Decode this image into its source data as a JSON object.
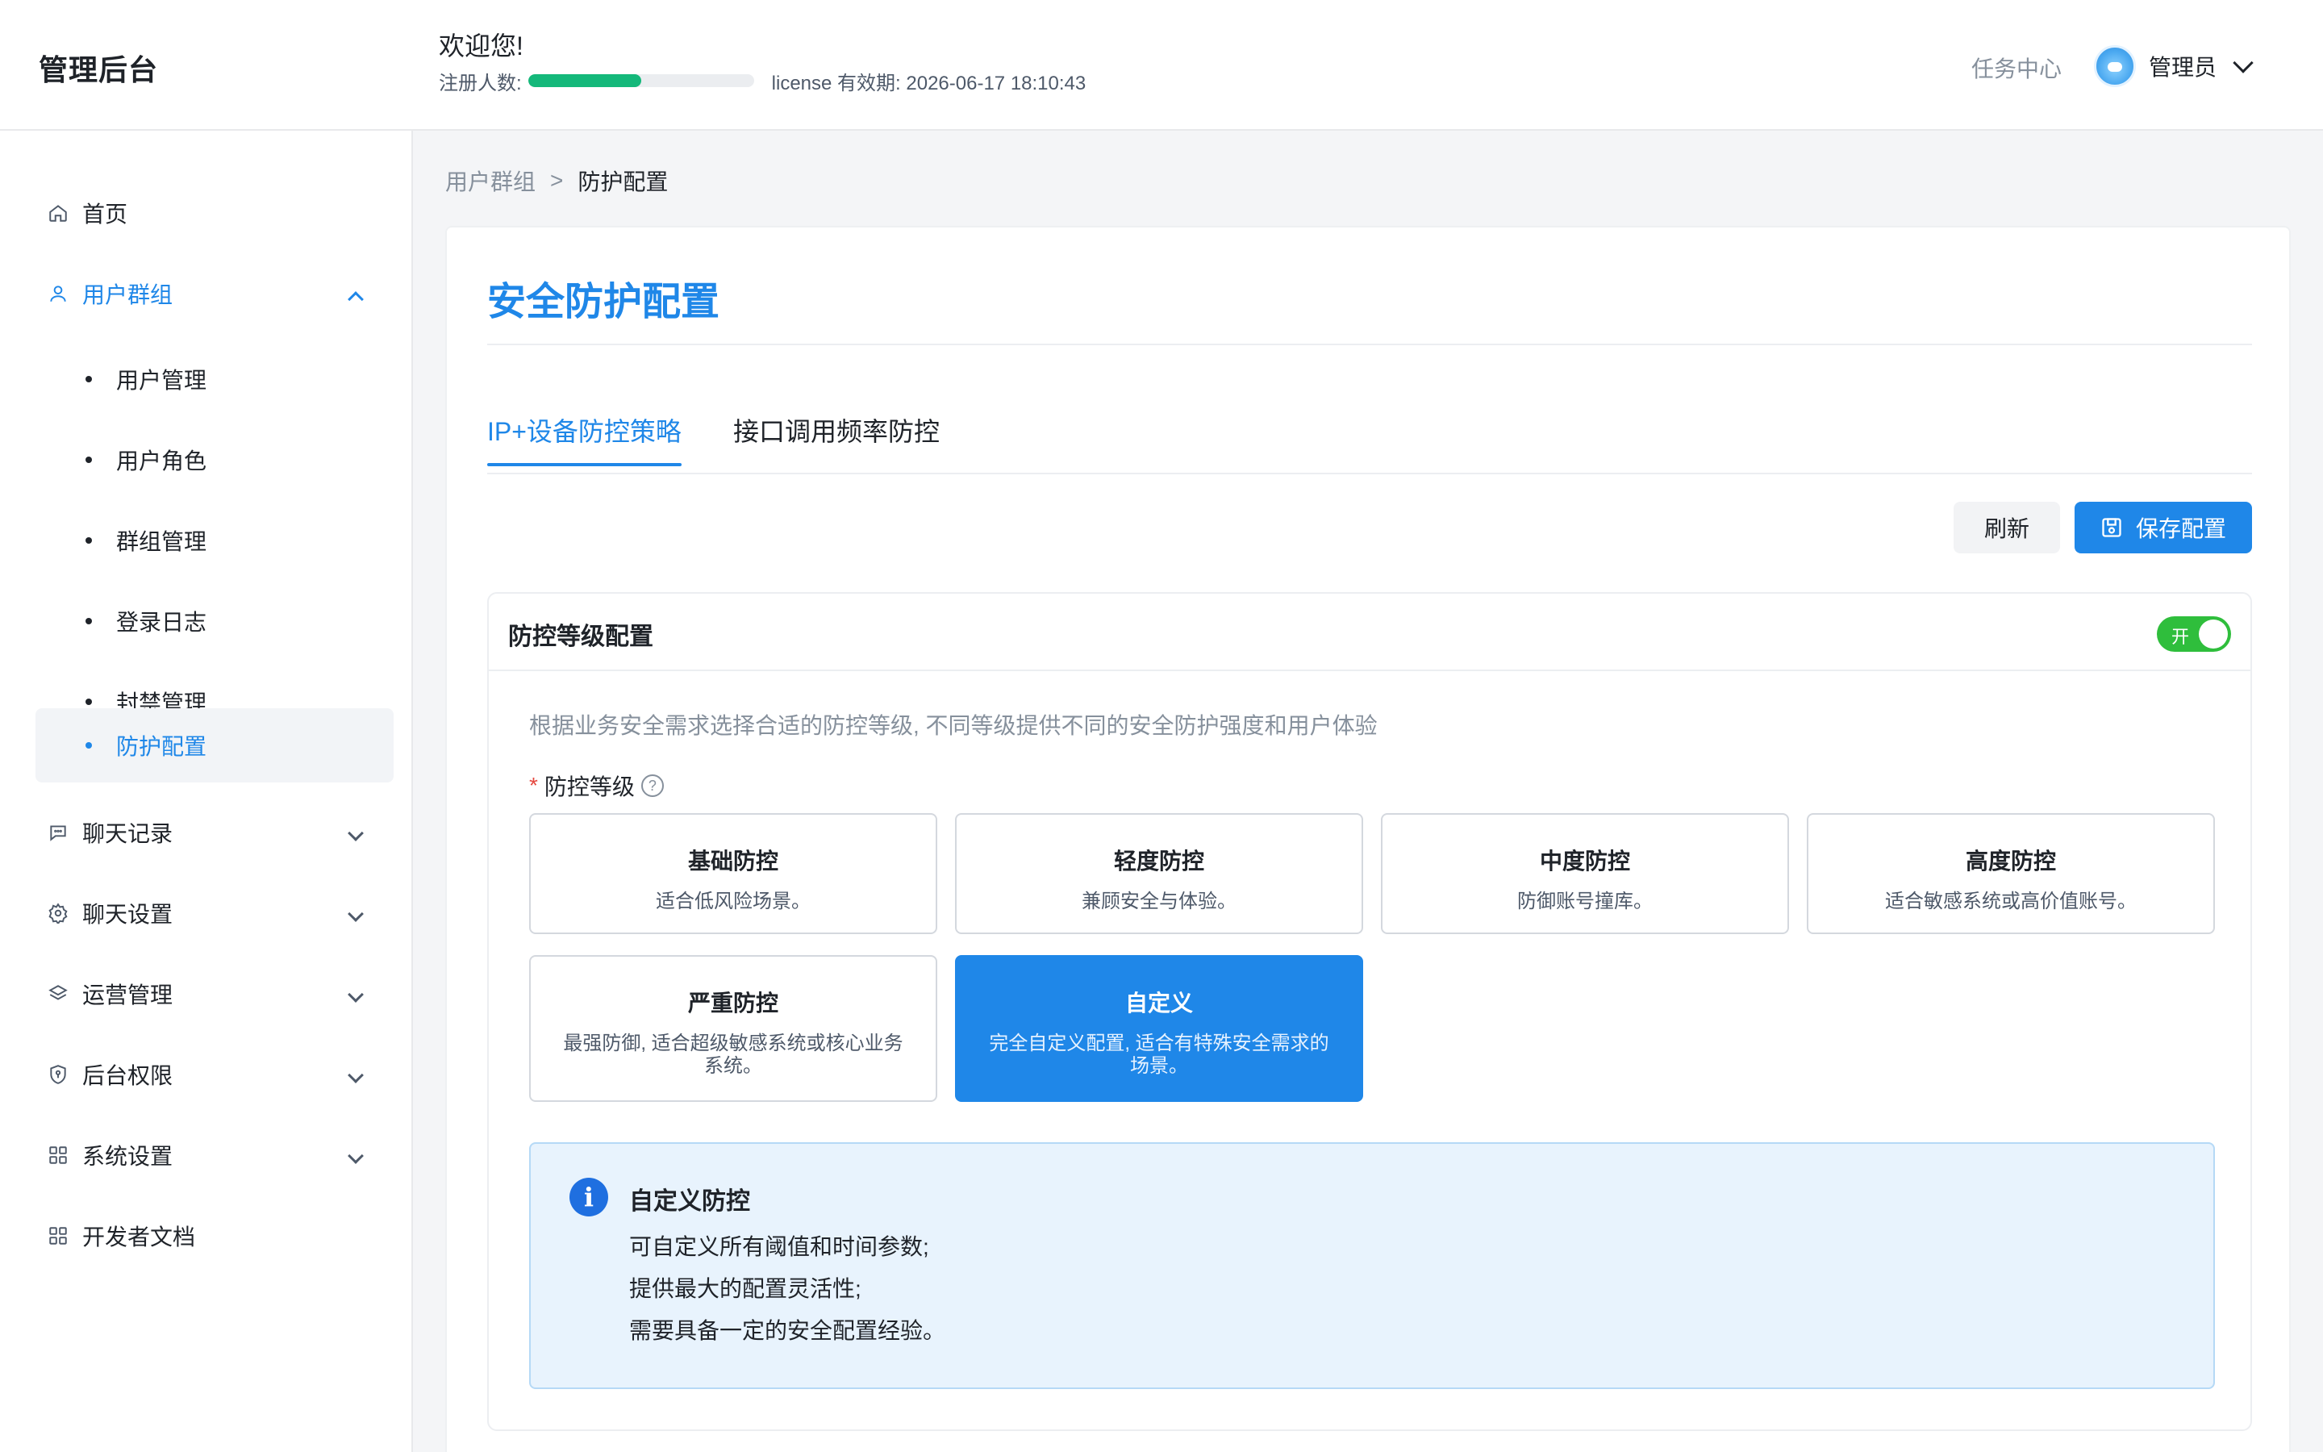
{
  "header": {
    "logo": "管理后台",
    "welcome": "欢迎您!",
    "registered_label": "注册人数:",
    "registered_progress": 0.5,
    "license_text": "license 有效期: 2026-06-17 18:10:43",
    "task_center": "任务中心",
    "user_name": "管理员"
  },
  "sidebar": {
    "items": [
      {
        "label": "首页",
        "icon": "home-icon"
      },
      {
        "label": "用户群组",
        "icon": "user-icon",
        "expanded": true
      },
      {
        "label": "聊天记录",
        "icon": "chat-icon"
      },
      {
        "label": "聊天设置",
        "icon": "gear-icon"
      },
      {
        "label": "运营管理",
        "icon": "layers-icon"
      },
      {
        "label": "后台权限",
        "icon": "shield-icon"
      },
      {
        "label": "系统设置",
        "icon": "grid-icon"
      },
      {
        "label": "开发者文档",
        "icon": "grid-icon"
      }
    ],
    "sub_items": [
      {
        "label": "用户管理"
      },
      {
        "label": "用户角色"
      },
      {
        "label": "群组管理"
      },
      {
        "label": "登录日志"
      },
      {
        "label": "封禁管理"
      },
      {
        "label": "防护配置",
        "active": true
      }
    ]
  },
  "breadcrumb": {
    "parent": "用户群组",
    "separator": ">",
    "current": "防护配置"
  },
  "main": {
    "title": "安全防护配置",
    "tabs": [
      {
        "label": "IP+设备防控策略",
        "active": true
      },
      {
        "label": "接口调用频率防控"
      }
    ],
    "refresh_label": "刷新",
    "save_label": "保存配置"
  },
  "panel": {
    "title": "防控等级配置",
    "toggle_label": "开",
    "toggle_on": true,
    "description": "根据业务安全需求选择合适的防控等级, 不同等级提供不同的安全防护强度和用户体验",
    "level_label": "防控等级",
    "required_mark": "*",
    "help_glyph": "?",
    "options": [
      {
        "title": "基础防控",
        "desc": "适合低风险场景。"
      },
      {
        "title": "轻度防控",
        "desc": "兼顾安全与体验。"
      },
      {
        "title": "中度防控",
        "desc": "防御账号撞库。"
      },
      {
        "title": "高度防控",
        "desc": "适合敏感系统或高价值账号。"
      },
      {
        "title": "严重防控",
        "desc": "最强防御, 适合超级敏感系统或核心业务系统。"
      },
      {
        "title": "自定义",
        "desc": "完全自定义配置, 适合有特殊安全需求的场景。",
        "selected": true
      }
    ],
    "info": {
      "icon_glyph": "i",
      "title": "自定义防控",
      "lines": [
        "可自定义所有阈值和时间参数;",
        "提供最大的配置灵活性;",
        "需要具备一定的安全配置经验。"
      ]
    }
  },
  "colors": {
    "accent": "#1f87e8",
    "progress": "#14b87a",
    "toggle_on": "#2fbe3c",
    "info_bg": "#e8f3fd"
  }
}
